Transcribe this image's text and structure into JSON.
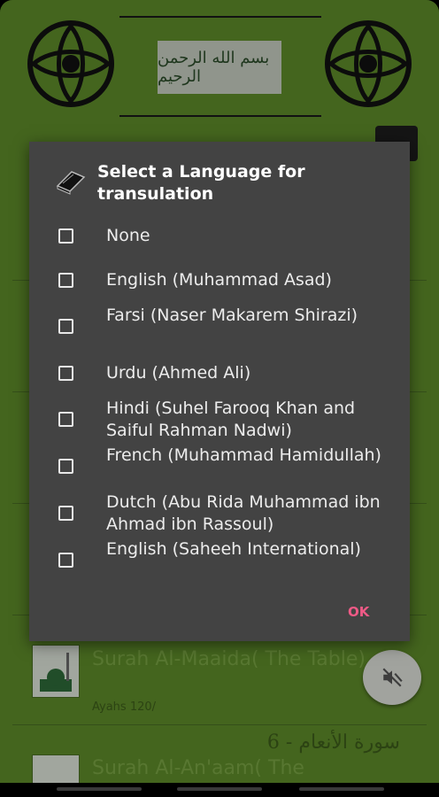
{
  "header": {
    "bismillah": "بسم الله الرحمن الرحيم"
  },
  "list": {
    "rows": [
      {
        "title": "Surah  Al-Maaida( The Table)",
        "ayahs": "Ayahs  120/"
      },
      {
        "arabic": "6 -  سورة الأنعام",
        "title": "Surah  Al-An'aam( The"
      }
    ]
  },
  "dialog": {
    "title": "Select a Language for transulation",
    "options": [
      {
        "label": "None",
        "checked": false
      },
      {
        "label": "English (Muhammad Asad)",
        "checked": false
      },
      {
        "label": "Farsi (Naser Makarem Shirazi)",
        "checked": false
      },
      {
        "label": "Urdu (Ahmed Ali)",
        "checked": false
      },
      {
        "label": "Hindi (Suhel Farooq Khan and Saiful Rahman Nadwi)",
        "checked": false
      },
      {
        "label": "French (Muhammad Hamidullah)",
        "checked": false
      },
      {
        "label": "Dutch (Abu Rida Muhammad ibn Ahmad ibn Rassoul)",
        "checked": false
      },
      {
        "label": "English (Saheeh International)",
        "checked": false
      }
    ],
    "ok_label": "OK"
  },
  "colors": {
    "app_background": "#5f8c2a",
    "dialog_background": "#434343",
    "accent": "#ef5a86"
  },
  "icons": {
    "dialog_icon": "quran-book-icon",
    "fab_icon": "volume-mute-icon"
  }
}
